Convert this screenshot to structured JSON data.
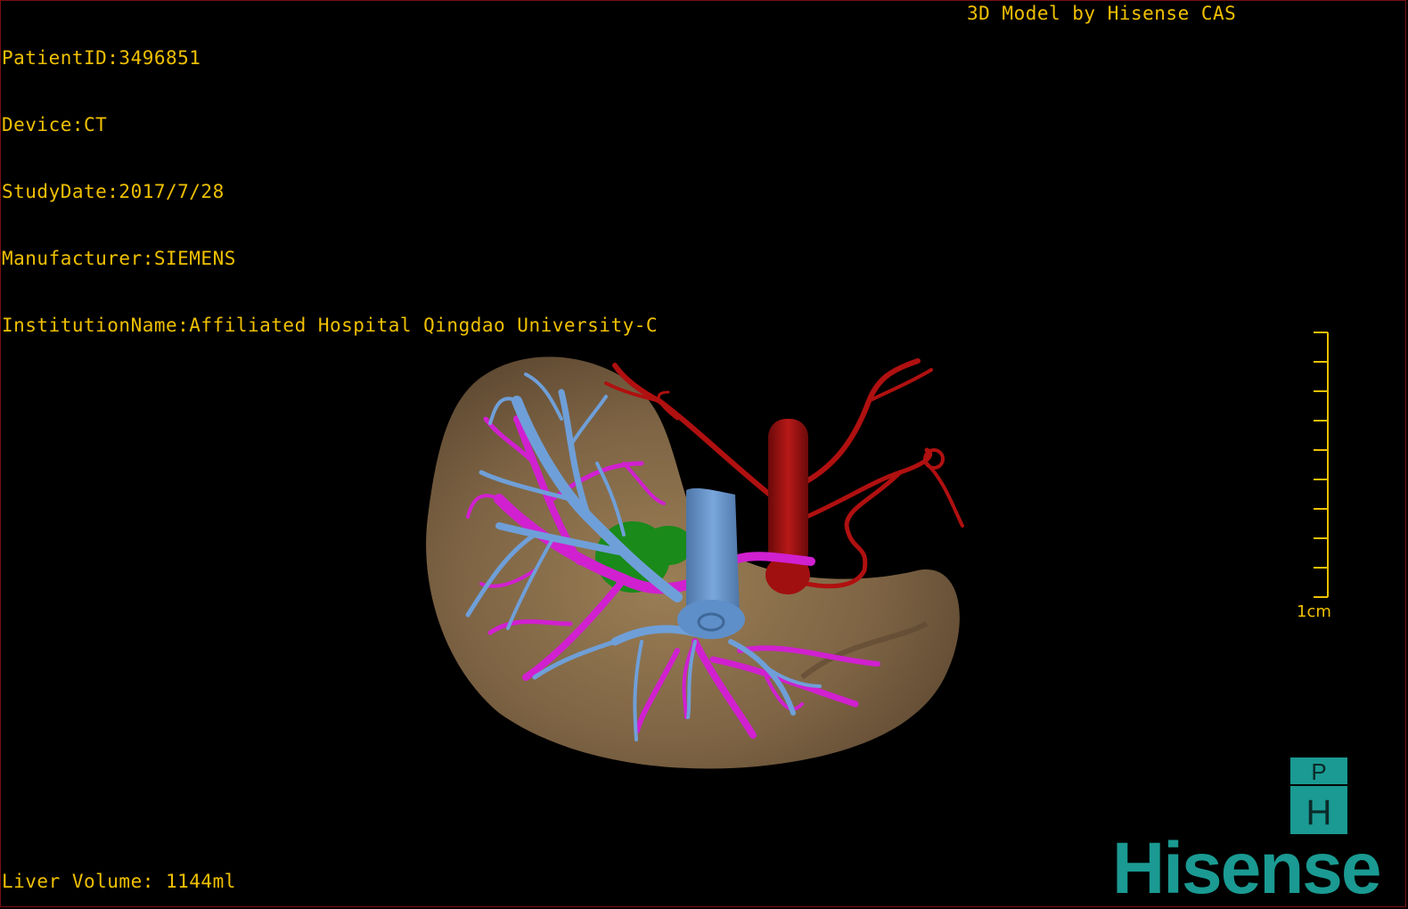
{
  "header": {
    "patient_id": "PatientID:3496851",
    "device": "Device:CT",
    "study_date": "StudyDate:2017/7/28",
    "manufacturer": "Manufacturer:SIEMENS",
    "institution": "InstitutionName:Affiliated Hospital Qingdao University-C",
    "credit": "3D Model by Hisense CAS"
  },
  "footer": {
    "liver_volume": "Liver Volume: 1144ml"
  },
  "scale": {
    "label": "1cm"
  },
  "logo": {
    "top_letter": "P",
    "bottom_letter": "H",
    "brand": "Hisense"
  },
  "colors": {
    "overlay_text": "#f0c000",
    "liver": "#8b7048",
    "hepatic_vein": "#6f9fd8",
    "portal_vein": "#d020d0",
    "artery": "#b01010",
    "gallbladder": "#1a8a1a",
    "brand": "#1a9a92"
  }
}
